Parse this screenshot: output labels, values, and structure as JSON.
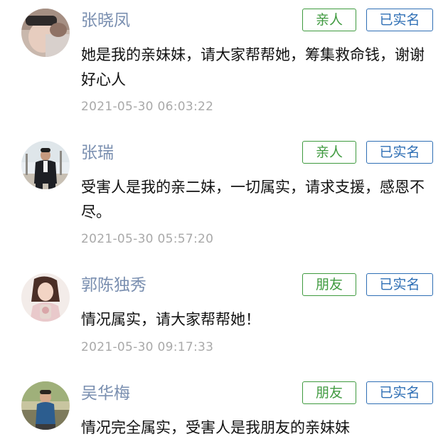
{
  "comments": [
    {
      "name": "张晓凤",
      "relation": "亲人",
      "verified": "已实名",
      "text": "她是我的亲妹妹，请大家帮帮她，筹集救命钱，谢谢好心人",
      "time": "2021-05-30 06:03:22"
    },
    {
      "name": "张瑞",
      "relation": "亲人",
      "verified": "已实名",
      "text": "受害人是我的亲二妹，一切属实，请求支援，感恩不尽。",
      "time": "2021-05-30 05:57:20"
    },
    {
      "name": "郭陈独秀",
      "relation": "朋友",
      "verified": "已实名",
      "text": "情况属实，请大家帮帮她！",
      "time": "2021-05-30 09:17:33"
    },
    {
      "name": "吴华梅",
      "relation": "朋友",
      "verified": "已实名",
      "text": "情况完全属实，受害人是我朋友的亲妹妹"
    }
  ],
  "colors": {
    "name": "#7a8fb0",
    "relation_tag": "#3f9a3f",
    "verified_tag": "#2f6fb5",
    "timestamp": "#a9a9a9",
    "body_text": "#111111"
  }
}
